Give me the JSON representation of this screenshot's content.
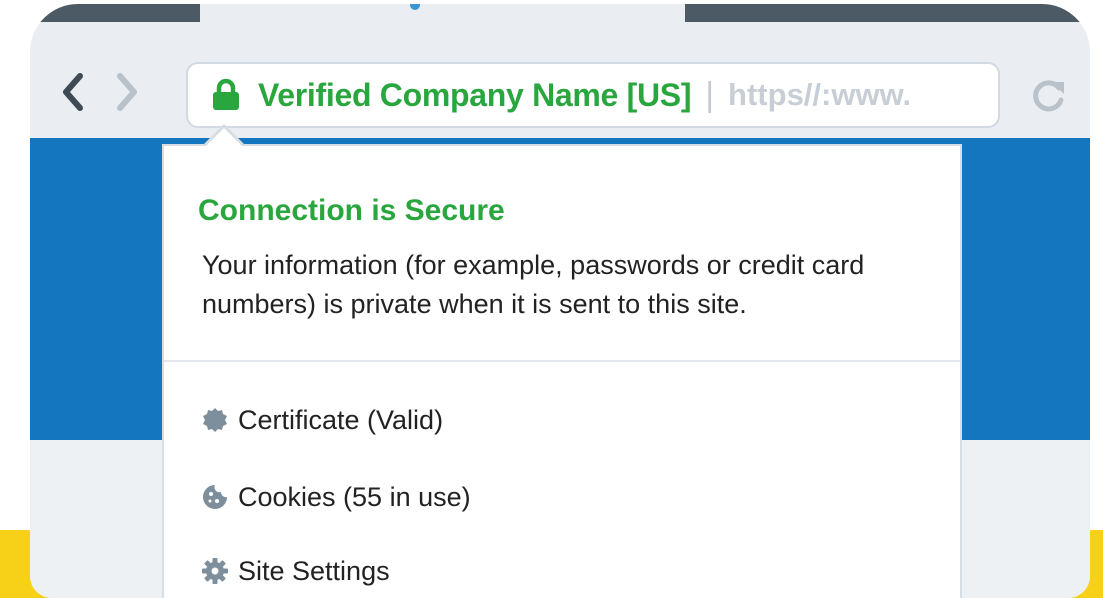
{
  "address_bar": {
    "site_identity": "Verified Company Name [US]",
    "separator": "|",
    "url": "https//:www."
  },
  "icons": {
    "back": "chevron-left-icon",
    "forward": "chevron-right-icon",
    "lock": "lock-icon",
    "reload": "reload-icon",
    "certificate": "certificate-badge-icon",
    "cookies": "cookie-icon",
    "settings": "gear-icon"
  },
  "security_popup": {
    "title": "Connection is Secure",
    "description": "Your information (for example, passwords or credit card numbers) is private when it is sent to this site.",
    "items": [
      {
        "label": "Certificate (Valid)"
      },
      {
        "label": "Cookies (55 in use)"
      },
      {
        "label": "Site Settings"
      }
    ]
  },
  "colors": {
    "secure_green": "#2aa63f",
    "page_blue": "#1476bf",
    "chrome_gray": "#eaedf1",
    "tab_dark": "#4c5a66",
    "icon_gray": "#7d8f9c",
    "accent_yellow": "#f7d117"
  }
}
